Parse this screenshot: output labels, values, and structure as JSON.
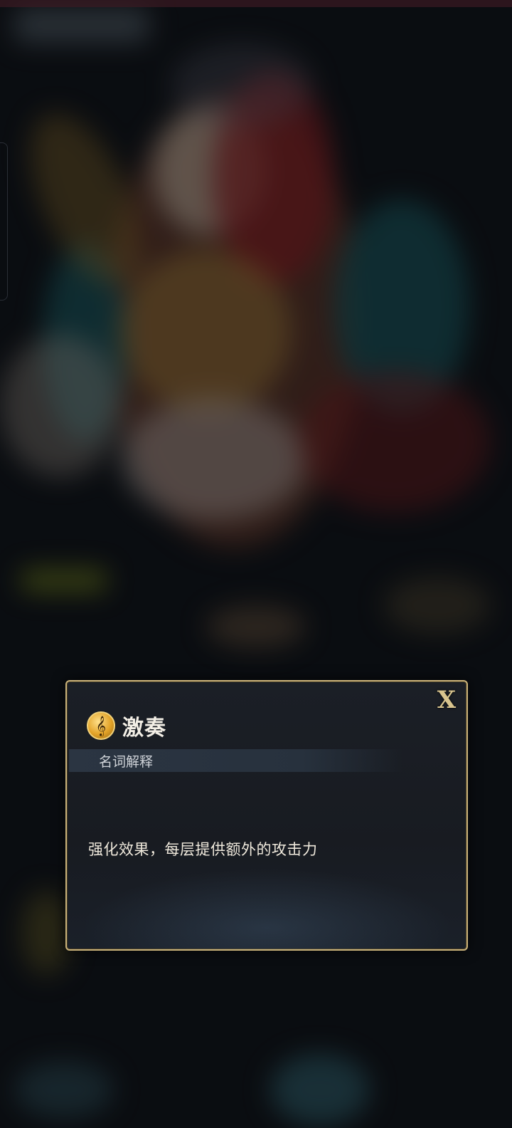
{
  "dialog": {
    "title": "激奏",
    "icon": "treble-clef-icon",
    "icon_glyph": "𝄞",
    "section_label": "名词解释",
    "description": "强化效果，每层提供额外的攻击力",
    "close_label": "X"
  },
  "colors": {
    "border_gold": "#c9b27a",
    "panel_bg": "#1b1f26",
    "badge_gold": "#e3a328",
    "text_light": "#f3efe6"
  }
}
